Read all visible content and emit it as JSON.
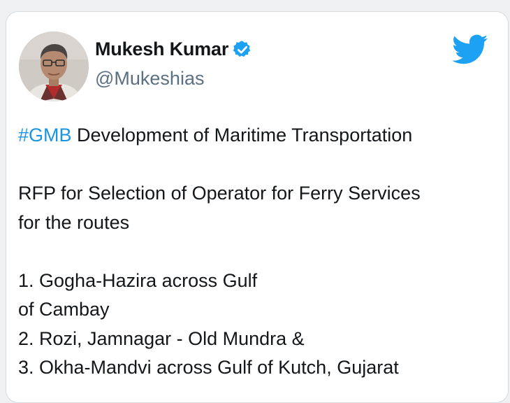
{
  "author": {
    "display_name": "Mukesh Kumar",
    "handle": "@Mukeshias",
    "verified": true,
    "avatar_icon": "profile-photo"
  },
  "brand": {
    "icon": "twitter-bird-icon",
    "color": "#1da1f2"
  },
  "colors": {
    "hashtag": "#1b95e0",
    "text": "#14171a",
    "handle": "#5b7083",
    "verified_badge": "#1da1f2"
  },
  "tweet": {
    "hashtag": "#GMB",
    "headline_rest": " Development of Maritime Transportation",
    "paragraph_line1": "RFP for Selection of Operator for Ferry Services",
    "paragraph_line2": "for the routes",
    "route1_line1": "1. Gogha-Hazira across Gulf",
    "route1_line2": "of Cambay",
    "route2": "2. Rozi, Jamnagar - Old Mundra &",
    "route3": "3. Okha-Mandvi across Gulf of Kutch, Gujarat"
  }
}
